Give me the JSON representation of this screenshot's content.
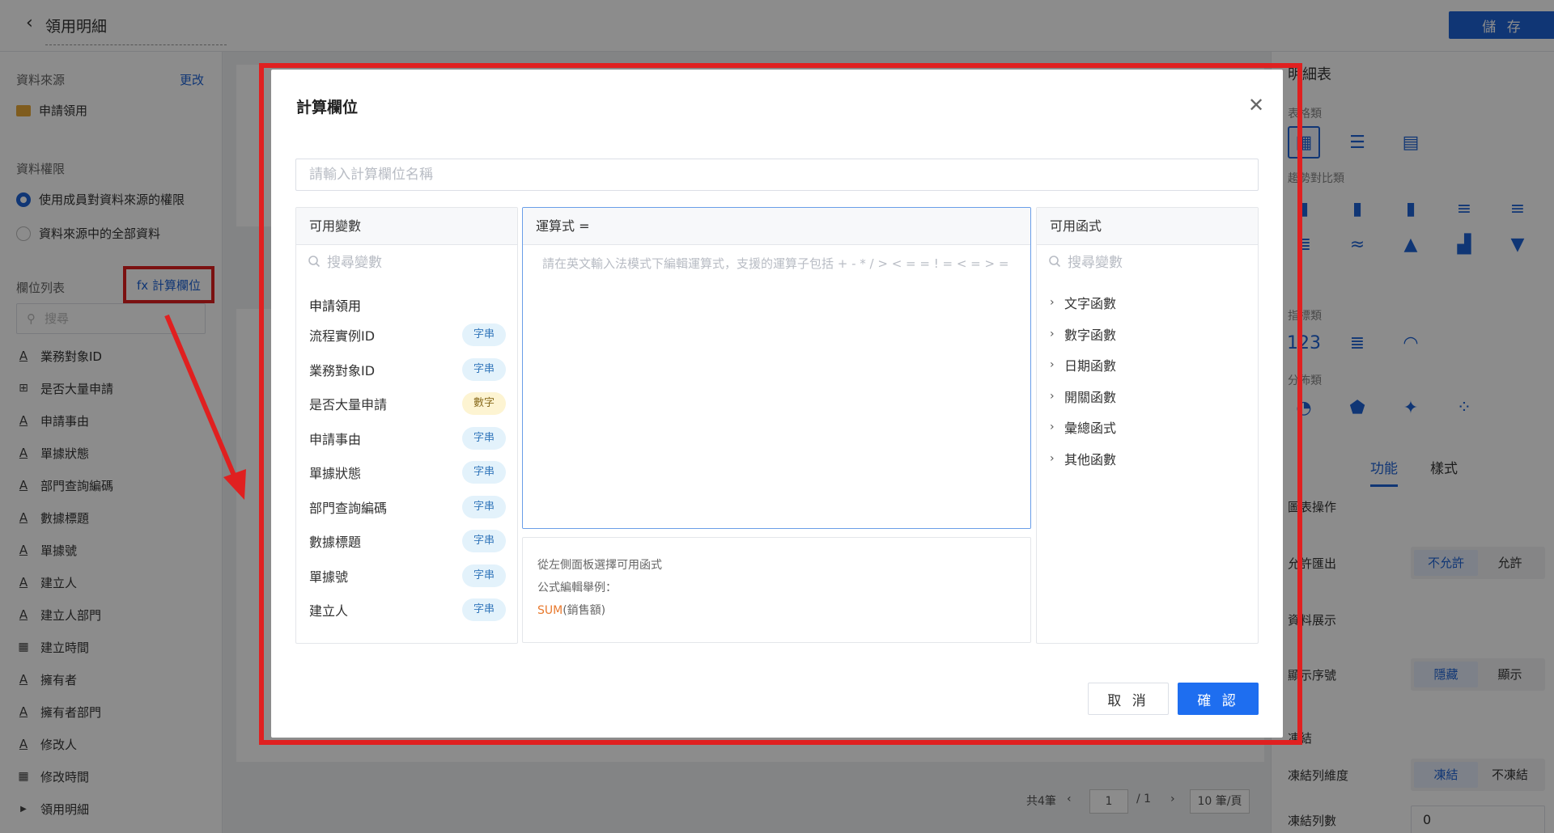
{
  "header": {
    "back_icon": "chevron-left-icon",
    "title": "領用明細",
    "save_label": "儲 存"
  },
  "left_panel": {
    "data_source_label": "資料來源",
    "change_link": "更改",
    "source_name": "申請領用",
    "permission_label": "資料權限",
    "permission_options": [
      "使用成員對資料來源的權限",
      "資料來源中的全部資料"
    ],
    "field_list_label": "欄位列表",
    "calc_field_link": "fx 計算欄位",
    "search_placeholder": "搜尋",
    "fields": [
      "業務對象ID",
      "是否大量申請",
      "申請事由",
      "單據狀態",
      "部門查詢編碼",
      "數據標題",
      "單據號",
      "建立人",
      "建立人部門",
      "建立時間",
      "擁有者",
      "擁有者部門",
      "修改人",
      "修改時間",
      "領用明細"
    ]
  },
  "pagination": {
    "total": "共4筆",
    "page": "1",
    "of": "/ 1",
    "page_size": "10 筆/頁"
  },
  "right_panel": {
    "title": "明細表",
    "sections": [
      "表格類",
      "趨勢對比類",
      "指標類",
      "分佈類"
    ],
    "tabs": [
      "功能",
      "樣式"
    ],
    "chart_ops_label": "圖表操作",
    "export_label": "允許匯出",
    "export_options": [
      "不允許",
      "允許"
    ],
    "display_label": "資料展示",
    "serial_label": "顯示序號",
    "serial_options": [
      "隱藏",
      "顯示"
    ],
    "freeze_label": "凍結",
    "freeze_dim_label": "凍結列維度",
    "freeze_options": [
      "凍結",
      "不凍結"
    ],
    "freeze_count_label": "凍結列數",
    "freeze_count_value": "0"
  },
  "modal": {
    "title": "計算欄位",
    "close_icon": "close-icon",
    "name_placeholder": "請輸入計算欄位名稱",
    "variables": {
      "header": "可用變數",
      "search_placeholder": "搜尋變數",
      "group": "申請領用",
      "items": [
        {
          "name": "流程實例ID",
          "type": "字串",
          "kind": "str"
        },
        {
          "name": "業務對象ID",
          "type": "字串",
          "kind": "str"
        },
        {
          "name": "是否大量申請",
          "type": "數字",
          "kind": "num"
        },
        {
          "name": "申請事由",
          "type": "字串",
          "kind": "str"
        },
        {
          "name": "單據狀態",
          "type": "字串",
          "kind": "str"
        },
        {
          "name": "部門查詢編碼",
          "type": "字串",
          "kind": "str"
        },
        {
          "name": "數據標題",
          "type": "字串",
          "kind": "str"
        },
        {
          "name": "單據號",
          "type": "字串",
          "kind": "str"
        },
        {
          "name": "建立人",
          "type": "字串",
          "kind": "str"
        }
      ]
    },
    "formula": {
      "header": "運算式 =",
      "placeholder": "請在英文輸入法模式下編輯運算式，支援的運算子包括 + - * / > < = = ! = < = > ="
    },
    "help": {
      "line1": "從左側面板選擇可用函式",
      "line2": "公式編輯舉例：",
      "example_fn": "SUM",
      "example_arg": "(銷售額)"
    },
    "functions": {
      "header": "可用函式",
      "search_placeholder": "搜尋變數",
      "items": [
        "文字函數",
        "數字函數",
        "日期函數",
        "開關函數",
        "彙總函式",
        "其他函數"
      ]
    },
    "cancel_label": "取 消",
    "ok_label": "確 認"
  },
  "colors": {
    "accent": "#1e63d6",
    "highlight": "#e02020",
    "example_fn": "#e8792d"
  }
}
